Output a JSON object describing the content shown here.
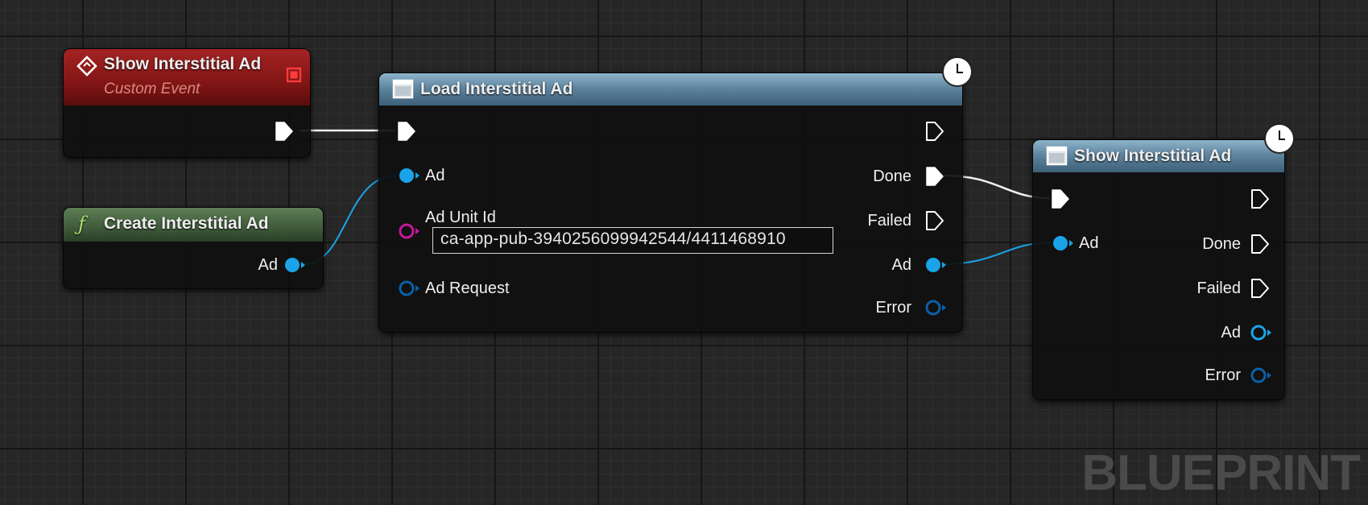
{
  "nodes": {
    "event": {
      "title": "Show Interstitial Ad",
      "subtitle": "Custom Event",
      "icon": "custom-event-diamond-icon",
      "header_color": "#8f1b1b"
    },
    "create": {
      "title": "Create Interstitial Ad",
      "icon": "function-icon",
      "icon_glyph": "ƒ",
      "header_color": "#4d6b47",
      "outputs": {
        "ad": "Ad"
      }
    },
    "load": {
      "title": "Load Interstitial Ad",
      "icon": "async-node-icon",
      "header_color": "#5f85a0",
      "inputs": {
        "ad": "Ad",
        "ad_unit_id": "Ad Unit Id",
        "ad_request": "Ad Request"
      },
      "ad_unit_id_value": "ca-app-pub-3940256099942544/4411468910",
      "outputs": {
        "done": "Done",
        "failed": "Failed",
        "ad": "Ad",
        "error": "Error"
      }
    },
    "show": {
      "title": "Show Interstitial Ad",
      "icon": "async-node-icon",
      "header_color": "#5f85a0",
      "inputs": {
        "ad": "Ad"
      },
      "outputs": {
        "done": "Done",
        "failed": "Failed",
        "ad": "Ad",
        "error": "Error"
      }
    }
  },
  "colors": {
    "exec_wire": "#ffffff",
    "object_wire": "#1aa3e8",
    "string_pin": "#c4189c",
    "struct_pin": "#0b5fa8"
  },
  "watermark": "BLUEPRINT"
}
